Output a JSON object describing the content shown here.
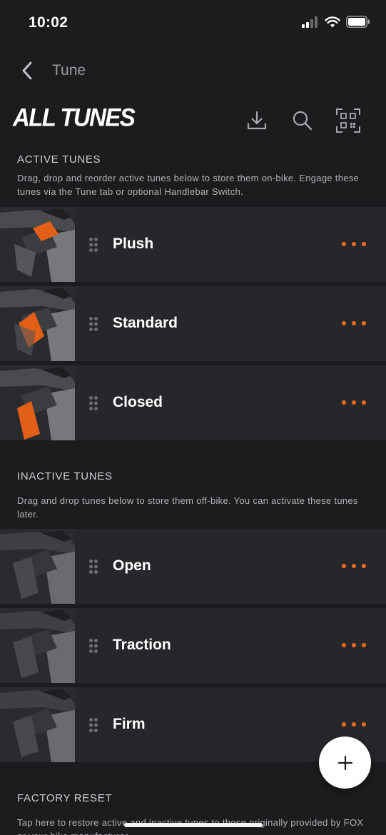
{
  "status_bar": {
    "time": "10:02"
  },
  "nav": {
    "back_label": "Tune"
  },
  "header": {
    "title": "ALL TUNES"
  },
  "active": {
    "title": "ACTIVE TUNES",
    "description": "Drag, drop and reorder active tunes below to store them on-bike. Engage these tunes via the Tune tab or optional Handlebar Switch.",
    "tunes": [
      {
        "name": "Plush"
      },
      {
        "name": "Standard"
      },
      {
        "name": "Closed"
      }
    ]
  },
  "inactive": {
    "title": "INACTIVE TUNES",
    "description": "Drag and drop tunes below to store them off-bike. You can activate these tunes later.",
    "tunes": [
      {
        "name": "Open"
      },
      {
        "name": "Traction"
      },
      {
        "name": "Firm"
      }
    ]
  },
  "reset": {
    "title": "FACTORY RESET",
    "description": "Tap here to restore active and inactive tunes to those originally provided by FOX or your bike manufacturer."
  },
  "icons": {
    "back": "chevron-left-icon",
    "download": "download-icon",
    "search": "search-icon",
    "qr": "qr-scan-icon",
    "drag": "drag-handle-icon",
    "menu": "more-horizontal-icon",
    "add": "plus-icon"
  },
  "colors": {
    "background": "#1c1c1e",
    "row": "#26272a",
    "accent": "#f26b1d",
    "text_secondary": "#b3b3b7"
  }
}
